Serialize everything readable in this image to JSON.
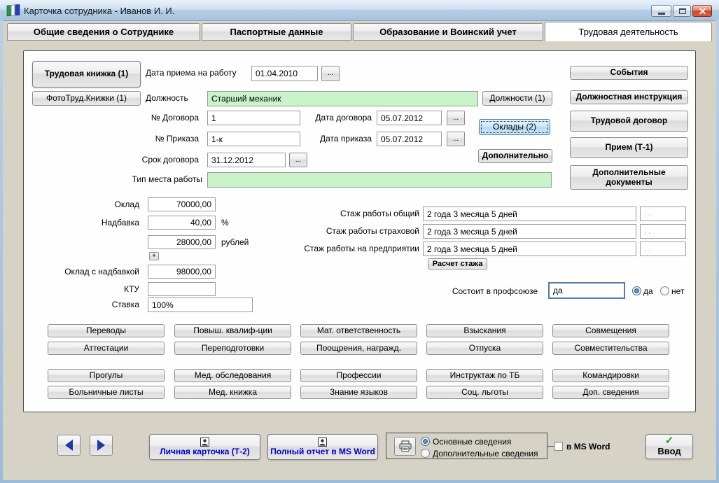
{
  "window": {
    "title": "Карточка сотрудника -  Иванов И. И."
  },
  "tabs": [
    "Общие сведения о Сотруднике",
    "Паспортные данные",
    "Образование и Воинский учет",
    "Трудовая деятельность"
  ],
  "left_buttons": {
    "work_book": "Трудовая книжка (1)",
    "photo_book": "ФотоТруд.Книжки (1)"
  },
  "form": {
    "dots": "...",
    "hire_date_label": "Дата приема на работу",
    "hire_date_value": "01.04.2010",
    "position_label": "Должность",
    "position_value": "Старший механик",
    "positions_button": "Должности (1)",
    "contract_no_label": "№ Договора",
    "contract_no_value": "1",
    "contract_date_label": "Дата договора",
    "contract_date_value": "05.07.2012",
    "order_no_label": "№ Приказа",
    "order_no_value": "1-к",
    "order_date_label": "Дата приказа",
    "order_date_value": "05.07.2012",
    "contract_term_label": "Срок договора",
    "contract_term_value": "31.12.2012",
    "workplace_type_label": "Тип места работы",
    "workplace_type_value": "",
    "salaries_button": "Оклады (2)",
    "additional_button": "Дополнительно",
    "salary_label": "Оклад",
    "salary_value": "70000,00",
    "bonus_label": "Надбавка",
    "bonus_percent_value": "40,00",
    "percent_unit": "%",
    "bonus_rub_value": "28000,00",
    "rub_unit": "рублей",
    "plus_button": "+",
    "salary_with_bonus_label": "Оклад с надбавкой",
    "salary_with_bonus_value": "98000,00",
    "ktu_label": "КТУ",
    "ktu_value": "",
    "rate_label": "Ставка",
    "rate_value": "100%",
    "seniority_rows": [
      {
        "label": "Стаж работы общий",
        "value": "2 года 3 месяца 5 дней",
        "extra": ". ."
      },
      {
        "label": "Стаж работы страховой",
        "value": "2 года 3 месяца 5 дней",
        "extra": ". ."
      },
      {
        "label": "Стаж работы на предприятии",
        "value": "2 года 3 месяца 5 дней",
        "extra": ". ."
      }
    ],
    "seniority_calc_button": "Расчет стажа",
    "union_label": "Состоит в профсоюзе",
    "union_value": "да",
    "union_yes_label": "да",
    "union_no_label": "нет"
  },
  "right_buttons": [
    "События",
    "Должностная инструкция",
    "Трудовой договор",
    "Прием (Т-1)",
    "Дополнительные документы"
  ],
  "grid": {
    "row1": [
      "Переводы",
      "Повыш. квалиф-ции",
      "Мат. ответственность",
      "Взыскания",
      "Совмещения"
    ],
    "row2": [
      "Аттестации",
      "Переподготовки",
      "Поощрения, награжд.",
      "Отпуска",
      "Совместительства"
    ],
    "row3": [
      "Прогулы",
      "Мед. обследования",
      "Профессии",
      "Инструктаж по ТБ",
      "Командировки"
    ],
    "row4": [
      "Больничные листы",
      "Мед. книжка",
      "Знание языков",
      "Соц. льготы",
      "Доп. сведения"
    ]
  },
  "footer": {
    "personal_card_button": "Личная карточка (Т-2)",
    "word_report_button": "Полный отчет в MS Word",
    "print_main_radio": "Основные сведения",
    "print_additional_radio": "Дополнительные сведения",
    "word_checkbox_label": "в MS Word",
    "enter_button": "Ввод",
    "check_mark": "✓"
  },
  "colors": {
    "green_field": "#c9f3c9",
    "focus_button_border": "#3f7fb5",
    "link_text": "#0000cc",
    "selected_radio": "#25477e",
    "close_button": "#ce452c",
    "body_background": "#d6d2c6"
  }
}
